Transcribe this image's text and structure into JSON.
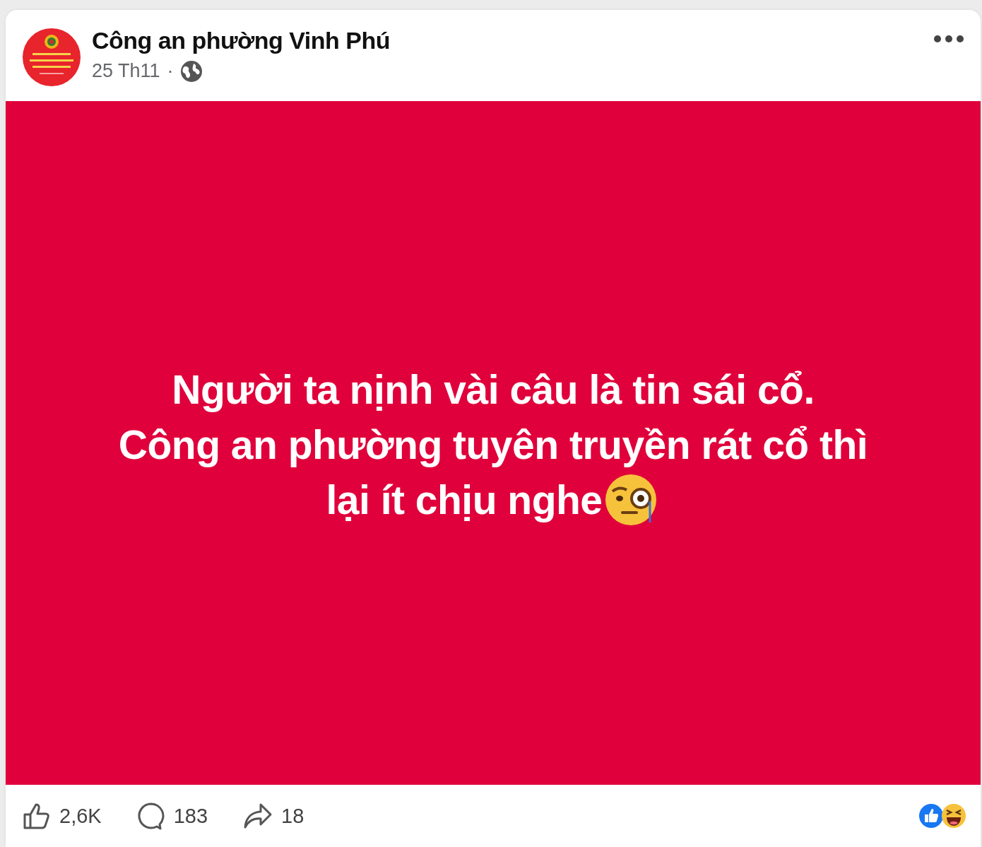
{
  "post": {
    "author": "Công an phường Vinh Phú",
    "date": "25 Th11",
    "separator": "·",
    "status_lines": [
      "Người ta nịnh vài câu là tin sái cổ.",
      "Công an phường tuyên truyền rát cổ thì",
      "lại ít chịu nghe"
    ],
    "stats": [
      {
        "kind": "like",
        "count": "2,6K"
      },
      {
        "kind": "comment",
        "count": "183"
      },
      {
        "kind": "share",
        "count": "18"
      }
    ]
  }
}
